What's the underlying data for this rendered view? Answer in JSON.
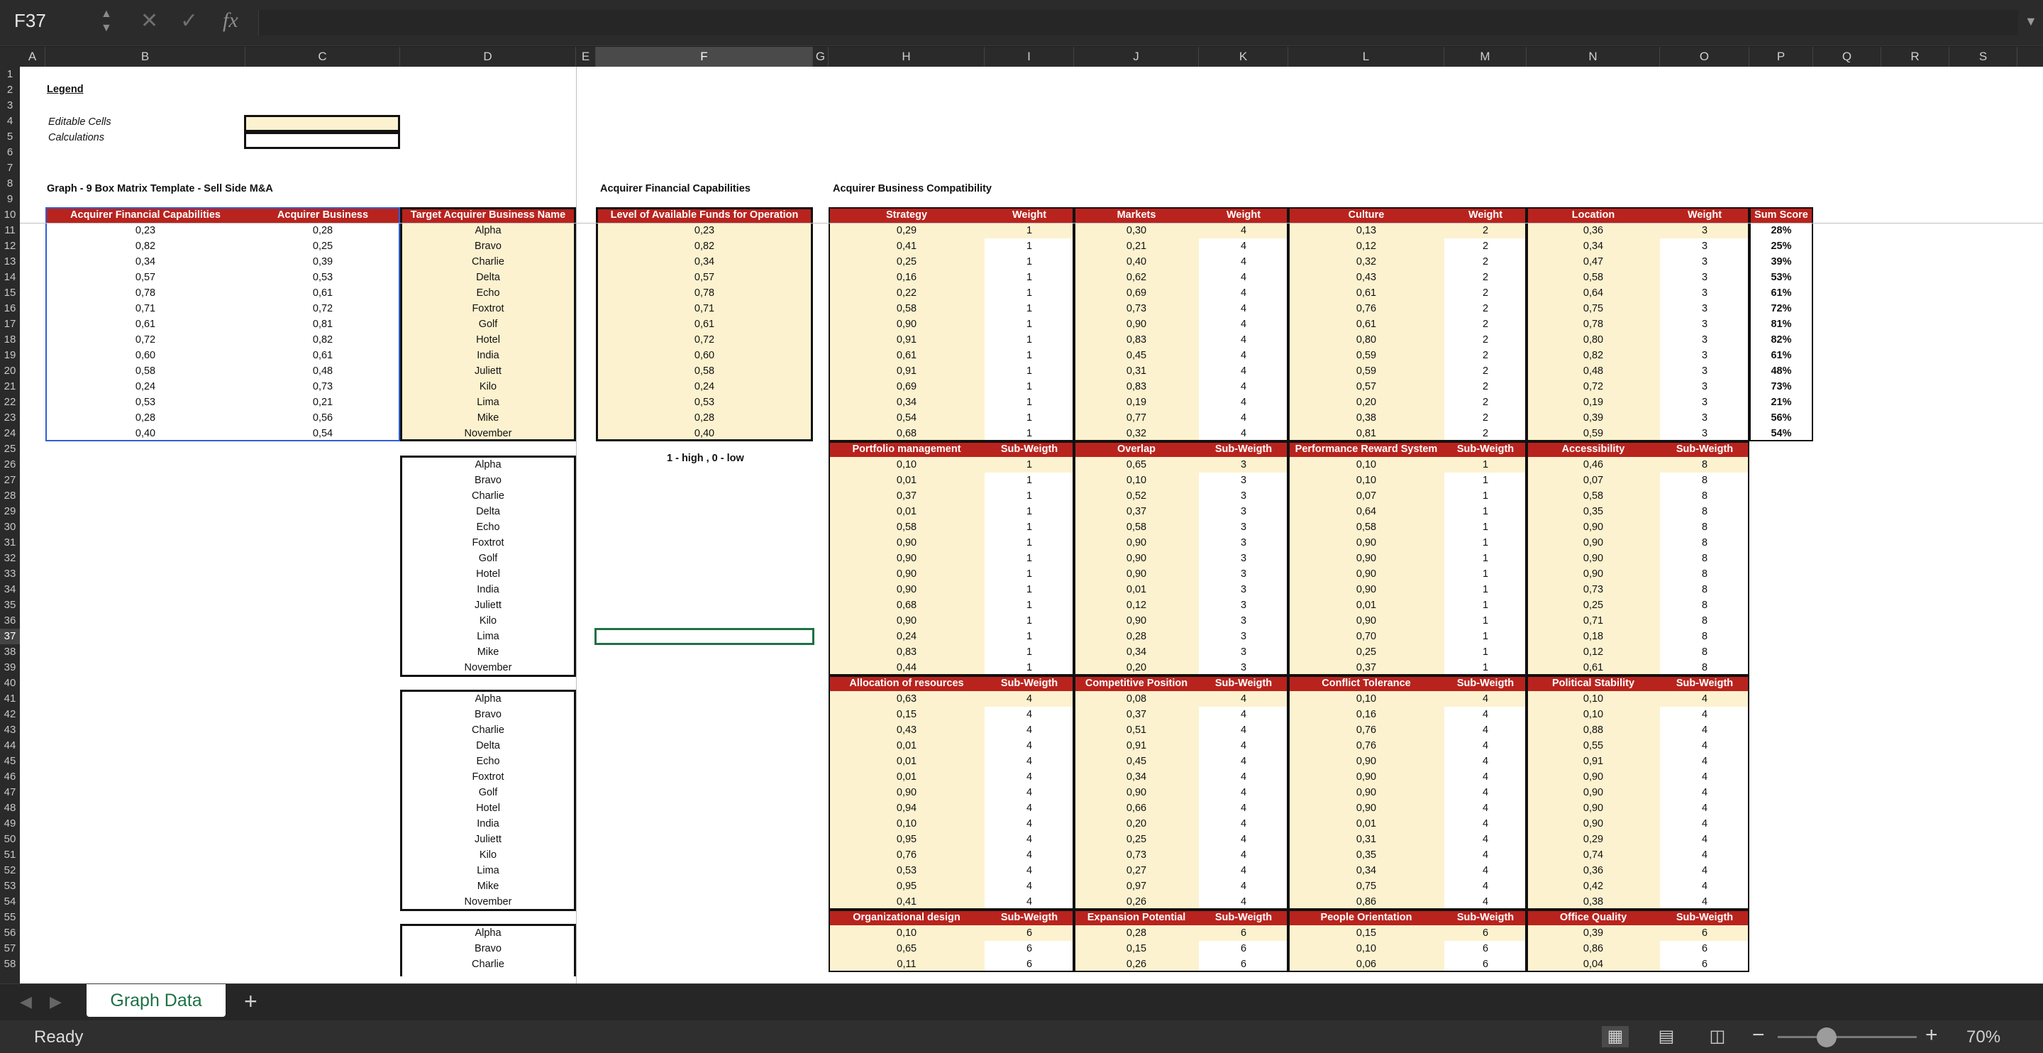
{
  "formula_bar": {
    "name_box": "F37",
    "cancel_icon": "✕",
    "enter_icon": "✓",
    "fx_label": "fx",
    "formula": ""
  },
  "columns": [
    "A",
    "B",
    "C",
    "D",
    "E",
    "F",
    "G",
    "H",
    "I",
    "J",
    "K",
    "L",
    "M",
    "N",
    "O",
    "P",
    "Q",
    "R",
    "S"
  ],
  "selected_column": "F",
  "selected_row": 37,
  "rows_visible": 58,
  "legend": {
    "title": "Legend",
    "editable": "Editable Cells",
    "calculations": "Calculations"
  },
  "titles": {
    "graph": "Graph - 9 Box Matrix Template - Sell Side M&A",
    "acq_fin": "Acquirer Financial Capabilities",
    "acq_bus": "Acquirer Business Compatibility",
    "note": "1 - high , 0 - low"
  },
  "left_table": {
    "headers": [
      "Acquirer Financial Capabilities",
      "Acquirer  Business Compatibility",
      "Target Acquirer Business Name"
    ],
    "fin": [
      "0,23",
      "0,82",
      "0,34",
      "0,57",
      "0,78",
      "0,71",
      "0,61",
      "0,72",
      "0,60",
      "0,58",
      "0,24",
      "0,53",
      "0,28",
      "0,40"
    ],
    "bus": [
      "0,28",
      "0,25",
      "0,39",
      "0,53",
      "0,61",
      "0,72",
      "0,81",
      "0,82",
      "0,61",
      "0,48",
      "0,73",
      "0,21",
      "0,56",
      "0,54"
    ],
    "names": [
      "Alpha",
      "Bravo",
      "Charlie",
      "Delta",
      "Echo",
      "Foxtrot",
      "Golf",
      "Hotel",
      "India",
      "Juliett",
      "Kilo",
      "Lima",
      "Mike",
      "November"
    ]
  },
  "funds": {
    "header": "Level of Available Funds for Operation",
    "values": [
      "0,23",
      "0,82",
      "0,34",
      "0,57",
      "0,78",
      "0,71",
      "0,61",
      "0,72",
      "0,60",
      "0,58",
      "0,24",
      "0,53",
      "0,28",
      "0,40"
    ]
  },
  "name_lists": [
    [
      "Alpha",
      "Bravo",
      "Charlie",
      "Delta",
      "Echo",
      "Foxtrot",
      "Golf",
      "Hotel",
      "India",
      "Juliett",
      "Kilo",
      "Lima",
      "Mike",
      "November"
    ],
    [
      "Alpha",
      "Bravo",
      "Charlie",
      "Delta",
      "Echo",
      "Foxtrot",
      "Golf",
      "Hotel",
      "India",
      "Juliett",
      "Kilo",
      "Lima",
      "Mike",
      "November"
    ],
    [
      "Alpha",
      "Bravo",
      "Charlie"
    ]
  ],
  "blocks": [
    {
      "groups": [
        {
          "h": "Strategy",
          "w": "Weight",
          "vals": [
            "0,29",
            "0,41",
            "0,25",
            "0,16",
            "0,22",
            "0,58",
            "0,90",
            "0,91",
            "0,61",
            "0,91",
            "0,69",
            "0,34",
            "0,54",
            "0,68"
          ],
          "wv": "1"
        },
        {
          "h": "Markets",
          "w": "Weight",
          "vals": [
            "0,30",
            "0,21",
            "0,40",
            "0,62",
            "0,69",
            "0,73",
            "0,90",
            "0,83",
            "0,45",
            "0,31",
            "0,83",
            "0,19",
            "0,77",
            "0,32"
          ],
          "wv": "4"
        },
        {
          "h": "Culture",
          "w": "Weight",
          "vals": [
            "0,13",
            "0,12",
            "0,32",
            "0,43",
            "0,61",
            "0,76",
            "0,61",
            "0,80",
            "0,59",
            "0,59",
            "0,57",
            "0,20",
            "0,38",
            "0,81"
          ],
          "wv": "2"
        },
        {
          "h": "Location",
          "w": "Weight",
          "vals": [
            "0,36",
            "0,34",
            "0,47",
            "0,58",
            "0,64",
            "0,75",
            "0,78",
            "0,80",
            "0,82",
            "0,48",
            "0,72",
            "0,19",
            "0,39",
            "0,59"
          ],
          "wv": "3"
        }
      ],
      "sum": {
        "h": "Sum Score",
        "vals": [
          "28%",
          "25%",
          "39%",
          "53%",
          "61%",
          "72%",
          "81%",
          "82%",
          "61%",
          "48%",
          "73%",
          "21%",
          "56%",
          "54%"
        ]
      }
    },
    {
      "groups": [
        {
          "h": "Portfolio management",
          "w": "Sub-Weigth",
          "vals": [
            "0,10",
            "0,01",
            "0,37",
            "0,01",
            "0,58",
            "0,90",
            "0,90",
            "0,90",
            "0,90",
            "0,68",
            "0,90",
            "0,24",
            "0,83",
            "0,44"
          ],
          "wv": "1"
        },
        {
          "h": "Overlap",
          "w": "Sub-Weigth",
          "vals": [
            "0,65",
            "0,10",
            "0,52",
            "0,37",
            "0,58",
            "0,90",
            "0,90",
            "0,90",
            "0,01",
            "0,12",
            "0,90",
            "0,28",
            "0,34",
            "0,20"
          ],
          "wv": "3"
        },
        {
          "h": "Performance Reward System",
          "w": "Sub-Weigth",
          "vals": [
            "0,10",
            "0,10",
            "0,07",
            "0,64",
            "0,58",
            "0,90",
            "0,90",
            "0,90",
            "0,90",
            "0,01",
            "0,90",
            "0,70",
            "0,25",
            "0,37"
          ],
          "wv": "1"
        },
        {
          "h": "Accessibility",
          "w": "Sub-Weigth",
          "vals": [
            "0,46",
            "0,07",
            "0,58",
            "0,35",
            "0,90",
            "0,90",
            "0,90",
            "0,90",
            "0,73",
            "0,25",
            "0,71",
            "0,18",
            "0,12",
            "0,61"
          ],
          "wv": "8"
        }
      ]
    },
    {
      "groups": [
        {
          "h": "Allocation of resources",
          "w": "Sub-Weigth",
          "vals": [
            "0,63",
            "0,15",
            "0,43",
            "0,01",
            "0,01",
            "0,01",
            "0,90",
            "0,94",
            "0,10",
            "0,95",
            "0,76",
            "0,53",
            "0,95",
            "0,41"
          ],
          "wv": "4"
        },
        {
          "h": "Competitive Position",
          "w": "Sub-Weigth",
          "vals": [
            "0,08",
            "0,37",
            "0,51",
            "0,91",
            "0,45",
            "0,34",
            "0,90",
            "0,66",
            "0,20",
            "0,25",
            "0,73",
            "0,27",
            "0,97",
            "0,26"
          ],
          "wv": "4"
        },
        {
          "h": "Conflict Tolerance",
          "w": "Sub-Weigth",
          "vals": [
            "0,10",
            "0,16",
            "0,76",
            "0,76",
            "0,90",
            "0,90",
            "0,90",
            "0,90",
            "0,01",
            "0,31",
            "0,35",
            "0,34",
            "0,75",
            "0,86"
          ],
          "wv": "4"
        },
        {
          "h": "Political Stability",
          "w": "Sub-Weigth",
          "vals": [
            "0,10",
            "0,10",
            "0,88",
            "0,55",
            "0,91",
            "0,90",
            "0,90",
            "0,90",
            "0,90",
            "0,29",
            "0,74",
            "0,36",
            "0,42",
            "0,38"
          ],
          "wv": "4"
        }
      ]
    },
    {
      "groups": [
        {
          "h": "Organizational design",
          "w": "Sub-Weigth",
          "vals": [
            "0,10",
            "0,65",
            "0,11"
          ],
          "wv": "6"
        },
        {
          "h": "Expansion Potential",
          "w": "Sub-Weigth",
          "vals": [
            "0,28",
            "0,15",
            "0,26"
          ],
          "wv": "6"
        },
        {
          "h": "People Orientation",
          "w": "Sub-Weigth",
          "vals": [
            "0,15",
            "0,10",
            "0,06"
          ],
          "wv": "6"
        },
        {
          "h": "Office Quality",
          "w": "Sub-Weigth",
          "vals": [
            "0,39",
            "0,86",
            "0,04"
          ],
          "wv": "6"
        }
      ]
    }
  ],
  "tabs": {
    "active": "Graph Data",
    "add": "+"
  },
  "status": {
    "ready": "Ready",
    "zoom": "70%",
    "zoom_level": 0.35
  }
}
